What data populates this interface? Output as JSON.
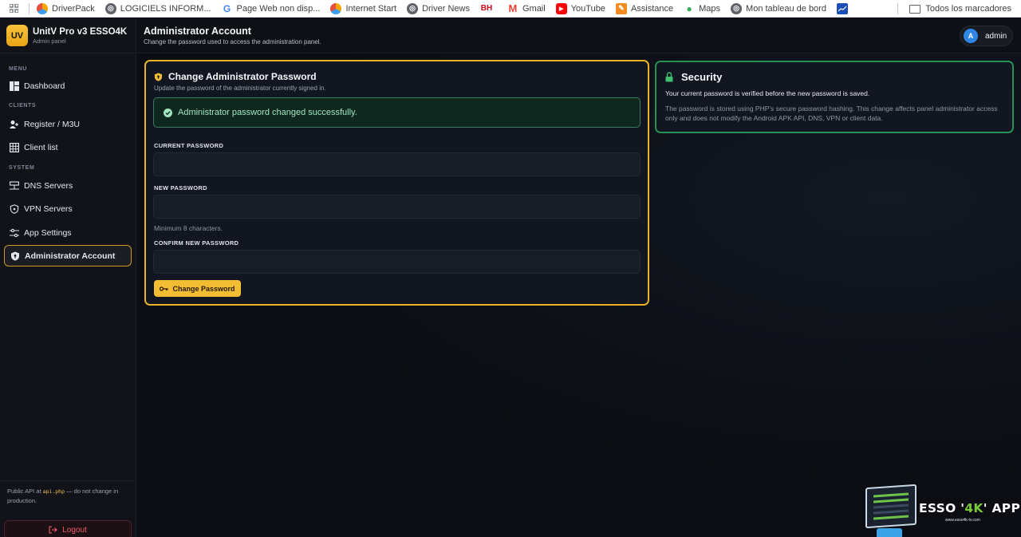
{
  "bookmarks": {
    "items": [
      {
        "label": "DriverPack",
        "icon": "driverpack-icon"
      },
      {
        "label": "LOGICIELS INFORM...",
        "icon": "globe-icon"
      },
      {
        "label": "Page Web non disp...",
        "icon": "google-icon"
      },
      {
        "label": "Internet Start",
        "icon": "driverpack-icon"
      },
      {
        "label": "Driver News",
        "icon": "globe-icon"
      },
      {
        "label": "",
        "icon": "bh-icon",
        "badge": "BH"
      },
      {
        "label": "Gmail",
        "icon": "gmail-icon"
      },
      {
        "label": "YouTube",
        "icon": "youtube-icon"
      },
      {
        "label": "Assistance",
        "icon": "assistance-icon"
      },
      {
        "label": "Maps",
        "icon": "maps-icon"
      },
      {
        "label": "Mon tableau de bord",
        "icon": "globe-icon"
      },
      {
        "label": "",
        "icon": "chart-icon"
      }
    ],
    "all_bookmarks": "Todos los marcadores"
  },
  "sidebar": {
    "brand": {
      "logo": "UV",
      "title": "UnitV Pro v3 ESSO4K",
      "subtitle": "Admin panel"
    },
    "sections": {
      "menu": "MENU",
      "clients": "CLIENTS",
      "system": "SYSTEM"
    },
    "items": [
      {
        "label": "Dashboard",
        "icon": "dashboard-icon"
      },
      {
        "label": "Register / M3U",
        "icon": "user-add-icon"
      },
      {
        "label": "Client list",
        "icon": "table-icon"
      },
      {
        "label": "DNS Servers",
        "icon": "server-icon"
      },
      {
        "label": "VPN Servers",
        "icon": "shield-icon"
      },
      {
        "label": "App Settings",
        "icon": "sliders-icon"
      },
      {
        "label": "Administrator Account",
        "icon": "shield-filled-icon",
        "active": true
      }
    ],
    "api_note_prefix": "Public API at ",
    "api_note_code": "api.php",
    "api_note_suffix": " — do not change in production.",
    "logout": "Logout"
  },
  "header": {
    "title": "Administrator Account",
    "subtitle": "Change the password used to access the administration panel.",
    "user": {
      "initial": "A",
      "name": "admin"
    }
  },
  "password_card": {
    "title": "Change Administrator Password",
    "subtitle": "Update the password of the administrator currently signed in.",
    "alert": "Administrator password changed successfully.",
    "current_label": "CURRENT PASSWORD",
    "current_value": "",
    "new_label": "NEW PASSWORD",
    "new_value": "",
    "hint": "Minimum 8 characters.",
    "confirm_label": "CONFIRM NEW PASSWORD",
    "confirm_value": "",
    "button": "Change Password"
  },
  "security_card": {
    "title": "Security",
    "line1": "Your current password is verified before the new password is saved.",
    "line2": "The password is stored using PHP's secure password hashing. This change affects panel administrator access only and does not modify the Android APK API, DNS, VPN or client data."
  },
  "watermark": {
    "text_prefix": "ESSO '",
    "text_highlight": "4K",
    "text_suffix": "' APPS",
    "url": "www.esso4k-tv.com"
  },
  "colors": {
    "accent": "#f2bc33",
    "success": "#279055",
    "danger": "#f05a68",
    "background": "#0b0d12"
  }
}
